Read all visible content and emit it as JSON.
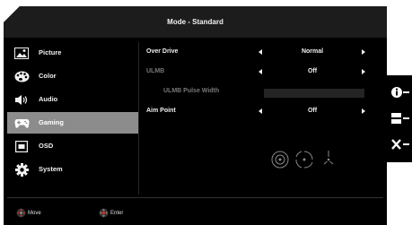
{
  "title": "Mode - Standard",
  "menu": [
    {
      "label": "Picture",
      "icon": "picture-icon"
    },
    {
      "label": "Color",
      "icon": "palette-icon"
    },
    {
      "label": "Audio",
      "icon": "speaker-icon"
    },
    {
      "label": "Gaming",
      "icon": "gamepad-icon",
      "active": true
    },
    {
      "label": "OSD",
      "icon": "osd-icon"
    },
    {
      "label": "System",
      "icon": "gear-icon"
    }
  ],
  "settings": {
    "over_drive": {
      "label": "Over Drive",
      "value": "Normal"
    },
    "ulmb": {
      "label": "ULMB",
      "value": "Off"
    },
    "ulmb_pulse_width": {
      "label": "ULMB Pulse Width"
    },
    "aim_point": {
      "label": "Aim Point",
      "value": "Off"
    }
  },
  "footer": {
    "move": "Move",
    "enter": "Enter"
  },
  "colors": {
    "background": "#000000",
    "active": "#8c8c8c",
    "disabled": "#777777",
    "dpad_center": "#c0392b"
  }
}
